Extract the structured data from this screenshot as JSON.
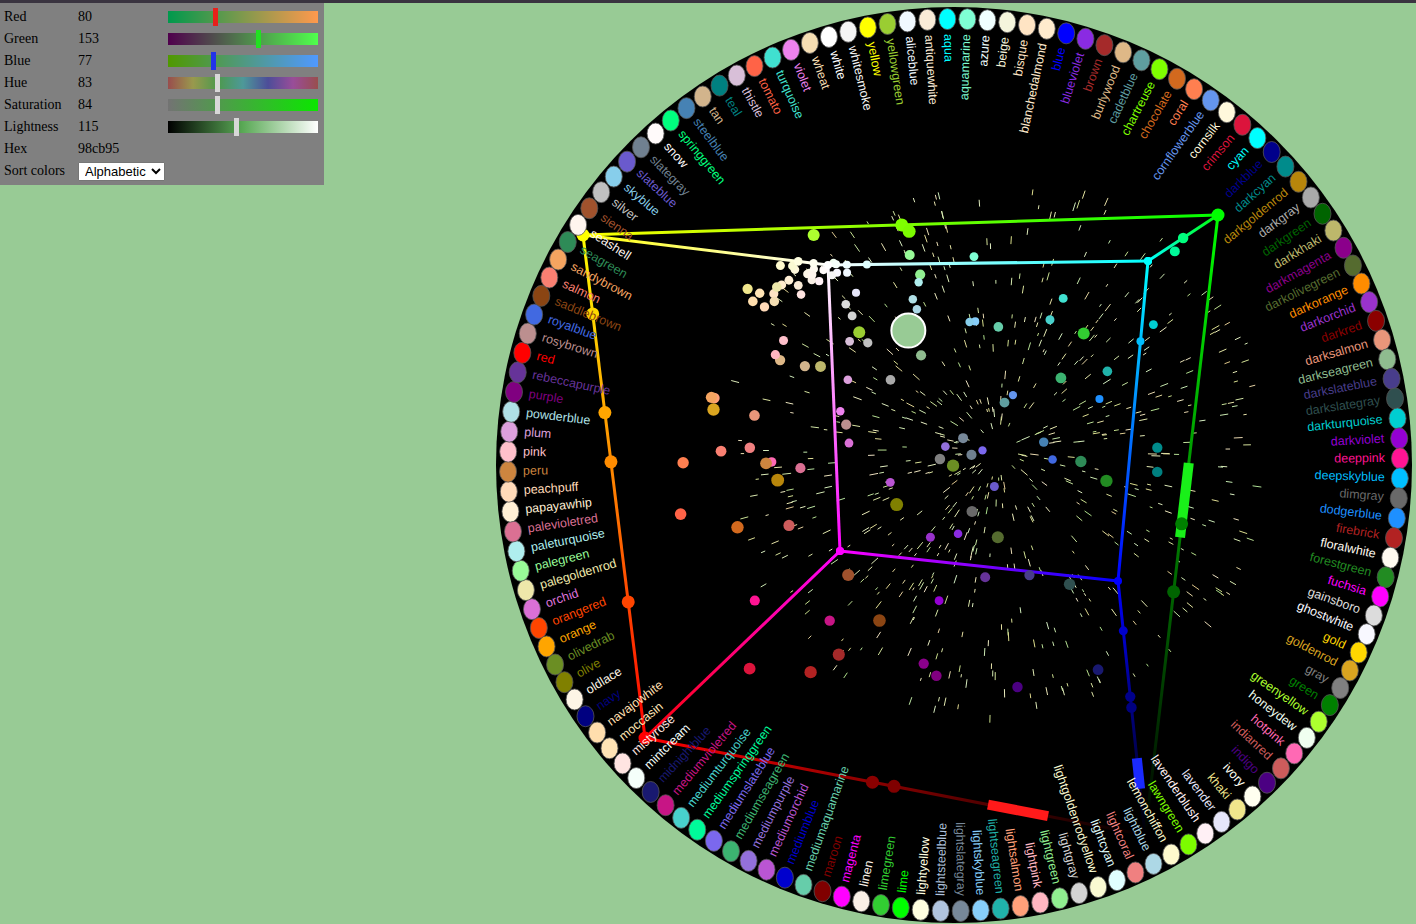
{
  "panel": {
    "rows": [
      {
        "label": "Red",
        "value": "80",
        "kind": "slider",
        "level": 0.314,
        "color": "#e8201a"
      },
      {
        "label": "Green",
        "value": "153",
        "kind": "slider",
        "level": 0.6,
        "color": "#22e022"
      },
      {
        "label": "Blue",
        "value": "77",
        "kind": "slider",
        "level": 0.302,
        "color": "#2233e8"
      },
      {
        "label": "Hue",
        "value": "83",
        "kind": "slider",
        "level": 0.325,
        "color": "#d8d8d8"
      },
      {
        "label": "Saturation",
        "value": "84",
        "kind": "slider",
        "level": 0.329,
        "color": "#d8d8d8"
      },
      {
        "label": "Lightness",
        "value": "115",
        "kind": "slider",
        "level": 0.451,
        "color": "#d8d8d8"
      },
      {
        "label": "Hex",
        "value": "98cb95",
        "kind": "text"
      },
      {
        "label": "Sort colors",
        "value": "Alphabetic",
        "kind": "select"
      }
    ]
  },
  "colors": [
    {
      "name": "aliceblue",
      "color": "#f0f8ff"
    },
    {
      "name": "antiquewhite",
      "color": "#faebd7"
    },
    {
      "name": "aqua",
      "color": "#00ffff"
    },
    {
      "name": "aquamarine",
      "color": "#7fffd4"
    },
    {
      "name": "azure",
      "color": "#f0ffff"
    },
    {
      "name": "beige",
      "color": "#f5f5dc"
    },
    {
      "name": "bisque",
      "color": "#ffe4c4"
    },
    {
      "name": "blanchedalmond",
      "color": "#ffebcd"
    },
    {
      "name": "blue",
      "color": "#0000ff"
    },
    {
      "name": "blueviolet",
      "color": "#8a2be2"
    },
    {
      "name": "brown",
      "color": "#a52a2a"
    },
    {
      "name": "burlywood",
      "color": "#deb887"
    },
    {
      "name": "cadetblue",
      "color": "#5f9ea0"
    },
    {
      "name": "chartreuse",
      "color": "#7fff00"
    },
    {
      "name": "chocolate",
      "color": "#d2691e"
    },
    {
      "name": "coral",
      "color": "#ff7f50"
    },
    {
      "name": "cornflowerblue",
      "color": "#6495ed"
    },
    {
      "name": "cornsilk",
      "color": "#fff8dc"
    },
    {
      "name": "crimson",
      "color": "#dc143c"
    },
    {
      "name": "cyan",
      "color": "#00ffff"
    },
    {
      "name": "darkblue",
      "color": "#00008b"
    },
    {
      "name": "darkcyan",
      "color": "#008b8b"
    },
    {
      "name": "darkgoldenrod",
      "color": "#b8860b"
    },
    {
      "name": "darkgray",
      "color": "#a9a9a9"
    },
    {
      "name": "darkgreen",
      "color": "#006400"
    },
    {
      "name": "darkkhaki",
      "color": "#bdb76b"
    },
    {
      "name": "darkmagenta",
      "color": "#8b008b"
    },
    {
      "name": "darkolivegreen",
      "color": "#556b2f"
    },
    {
      "name": "darkorange",
      "color": "#ff8c00"
    },
    {
      "name": "darkorchid",
      "color": "#9932cc"
    },
    {
      "name": "darkred",
      "color": "#8b0000"
    },
    {
      "name": "darksalmon",
      "color": "#e9967a"
    },
    {
      "name": "darkseagreen",
      "color": "#8fbc8f"
    },
    {
      "name": "darkslateblue",
      "color": "#483d8b"
    },
    {
      "name": "darkslategray",
      "color": "#2f4f4f"
    },
    {
      "name": "darkturquoise",
      "color": "#00ced1"
    },
    {
      "name": "darkviolet",
      "color": "#9400d3"
    },
    {
      "name": "deeppink",
      "color": "#ff1493"
    },
    {
      "name": "deepskyblue",
      "color": "#00bfff"
    },
    {
      "name": "dimgray",
      "color": "#696969"
    },
    {
      "name": "dodgerblue",
      "color": "#1e90ff"
    },
    {
      "name": "firebrick",
      "color": "#b22222"
    },
    {
      "name": "floralwhite",
      "color": "#fffaf0"
    },
    {
      "name": "forestgreen",
      "color": "#228b22"
    },
    {
      "name": "fuchsia",
      "color": "#ff00ff"
    },
    {
      "name": "gainsboro",
      "color": "#dcdcdc"
    },
    {
      "name": "ghostwhite",
      "color": "#f8f8ff"
    },
    {
      "name": "gold",
      "color": "#ffd700"
    },
    {
      "name": "goldenrod",
      "color": "#daa520"
    },
    {
      "name": "gray",
      "color": "#808080"
    },
    {
      "name": "green",
      "color": "#008000"
    },
    {
      "name": "greenyellow",
      "color": "#adff2f"
    },
    {
      "name": "honeydew",
      "color": "#f0fff0"
    },
    {
      "name": "hotpink",
      "color": "#ff69b4"
    },
    {
      "name": "indianred",
      "color": "#cd5c5c"
    },
    {
      "name": "indigo",
      "color": "#4b0082"
    },
    {
      "name": "ivory",
      "color": "#fffff0"
    },
    {
      "name": "khaki",
      "color": "#f0e68c"
    },
    {
      "name": "lavender",
      "color": "#e6e6fa"
    },
    {
      "name": "lavenderblush",
      "color": "#fff0f5"
    },
    {
      "name": "lawngreen",
      "color": "#7cfc00"
    },
    {
      "name": "lemonchiffon",
      "color": "#fffacd"
    },
    {
      "name": "lightblue",
      "color": "#add8e6"
    },
    {
      "name": "lightcoral",
      "color": "#f08080"
    },
    {
      "name": "lightcyan",
      "color": "#e0ffff"
    },
    {
      "name": "lightgoldenrodyellow",
      "color": "#fafad2"
    },
    {
      "name": "lightgray",
      "color": "#d3d3d3"
    },
    {
      "name": "lightgreen",
      "color": "#90ee90"
    },
    {
      "name": "lightpink",
      "color": "#ffb6c1"
    },
    {
      "name": "lightsalmon",
      "color": "#ffa07a"
    },
    {
      "name": "lightseagreen",
      "color": "#20b2aa"
    },
    {
      "name": "lightskyblue",
      "color": "#87cefa"
    },
    {
      "name": "lightslategray",
      "color": "#778899"
    },
    {
      "name": "lightsteelblue",
      "color": "#b0c4de"
    },
    {
      "name": "lightyellow",
      "color": "#ffffe0"
    },
    {
      "name": "lime",
      "color": "#00ff00"
    },
    {
      "name": "limegreen",
      "color": "#32cd32"
    },
    {
      "name": "linen",
      "color": "#faf0e6"
    },
    {
      "name": "magenta",
      "color": "#ff00ff"
    },
    {
      "name": "maroon",
      "color": "#800000"
    },
    {
      "name": "mediumaquamarine",
      "color": "#66cdaa"
    },
    {
      "name": "mediumblue",
      "color": "#0000cd"
    },
    {
      "name": "mediumorchid",
      "color": "#ba55d3"
    },
    {
      "name": "mediumpurple",
      "color": "#9370db"
    },
    {
      "name": "mediumseagreen",
      "color": "#3cb371"
    },
    {
      "name": "mediumslateblue",
      "color": "#7b68ee"
    },
    {
      "name": "mediumspringgreen",
      "color": "#00fa9a"
    },
    {
      "name": "mediumturquoise",
      "color": "#48d1cc"
    },
    {
      "name": "mediumvioletred",
      "color": "#c71585"
    },
    {
      "name": "midnightblue",
      "color": "#191970"
    },
    {
      "name": "mintcream",
      "color": "#f5fffa"
    },
    {
      "name": "mistyrose",
      "color": "#ffe4e1"
    },
    {
      "name": "moccasin",
      "color": "#ffe4b5"
    },
    {
      "name": "navajowhite",
      "color": "#ffdead"
    },
    {
      "name": "navy",
      "color": "#000080"
    },
    {
      "name": "oldlace",
      "color": "#fdf5e6"
    },
    {
      "name": "olive",
      "color": "#808000"
    },
    {
      "name": "olivedrab",
      "color": "#6b8e23"
    },
    {
      "name": "orange",
      "color": "#ffa500"
    },
    {
      "name": "orangered",
      "color": "#ff4500"
    },
    {
      "name": "orchid",
      "color": "#da70d6"
    },
    {
      "name": "palegoldenrod",
      "color": "#eee8aa"
    },
    {
      "name": "palegreen",
      "color": "#98fb98"
    },
    {
      "name": "paleturquoise",
      "color": "#afeeee"
    },
    {
      "name": "palevioletred",
      "color": "#db7093"
    },
    {
      "name": "papayawhip",
      "color": "#ffefd5"
    },
    {
      "name": "peachpuff",
      "color": "#ffdab9"
    },
    {
      "name": "peru",
      "color": "#cd853f"
    },
    {
      "name": "pink",
      "color": "#ffc0cb"
    },
    {
      "name": "plum",
      "color": "#dda0dd"
    },
    {
      "name": "powderblue",
      "color": "#b0e0e6"
    },
    {
      "name": "purple",
      "color": "#800080"
    },
    {
      "name": "rebeccapurple",
      "color": "#663399"
    },
    {
      "name": "red",
      "color": "#ff0000"
    },
    {
      "name": "rosybrown",
      "color": "#bc8f8f"
    },
    {
      "name": "royalblue",
      "color": "#4169e1"
    },
    {
      "name": "saddlebrown",
      "color": "#8b4513"
    },
    {
      "name": "salmon",
      "color": "#fa8072"
    },
    {
      "name": "sandybrown",
      "color": "#f4a460"
    },
    {
      "name": "seagreen",
      "color": "#2e8b57"
    },
    {
      "name": "seashell",
      "color": "#fff5ee"
    },
    {
      "name": "sienna",
      "color": "#a0522d"
    },
    {
      "name": "silver",
      "color": "#c0c0c0"
    },
    {
      "name": "skyblue",
      "color": "#87ceeb"
    },
    {
      "name": "slateblue",
      "color": "#6a5acd"
    },
    {
      "name": "slategray",
      "color": "#708090"
    },
    {
      "name": "snow",
      "color": "#fffafa"
    },
    {
      "name": "springgreen",
      "color": "#00ff7f"
    },
    {
      "name": "steelblue",
      "color": "#4682b4"
    },
    {
      "name": "tan",
      "color": "#d2b48c"
    },
    {
      "name": "teal",
      "color": "#008080"
    },
    {
      "name": "thistle",
      "color": "#d8bfd8"
    },
    {
      "name": "tomato",
      "color": "#ff6347"
    },
    {
      "name": "turquoise",
      "color": "#40e0d0"
    },
    {
      "name": "violet",
      "color": "#ee82ee"
    },
    {
      "name": "wheat",
      "color": "#f5deb3"
    },
    {
      "name": "white",
      "color": "#ffffff"
    },
    {
      "name": "whitesmoke",
      "color": "#f5f5f5"
    },
    {
      "name": "yellow",
      "color": "#ffff00"
    },
    {
      "name": "yellowgreen",
      "color": "#9acd32"
    }
  ]
}
